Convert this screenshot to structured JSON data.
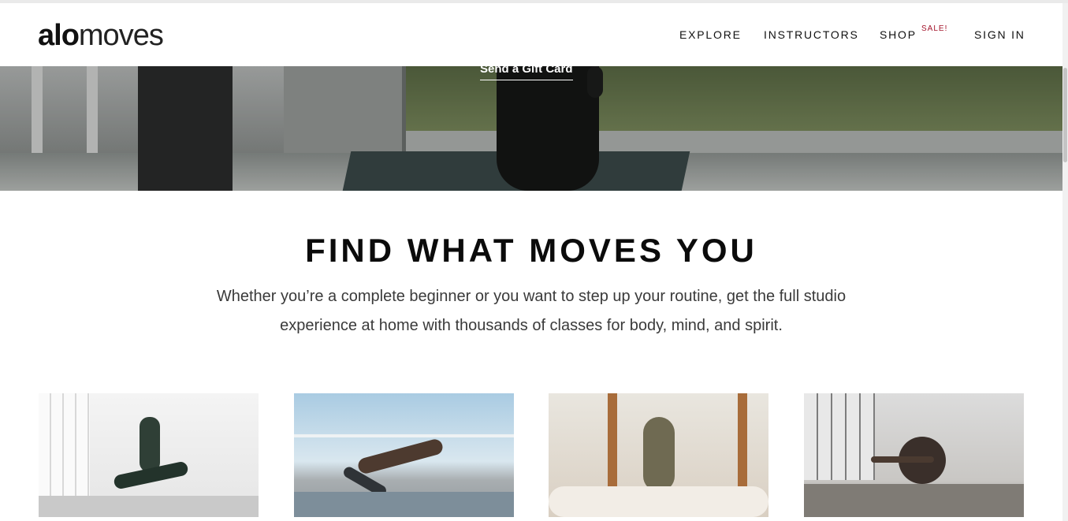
{
  "header": {
    "logo_bold": "alo",
    "logo_light": "moves",
    "nav": {
      "explore": "EXPLORE",
      "instructors": "INSTRUCTORS",
      "shop": "SHOP",
      "sale_badge": "SALE!",
      "sign_in": "SIGN IN"
    }
  },
  "hero": {
    "gift_link": "Send a Gift Card"
  },
  "section": {
    "title": "FIND WHAT MOVES YOU",
    "line1": "Whether you’re a complete beginner or you want to step up your routine, get the full studio",
    "line2": "experience at home with thousands of classes for body, mind, and spirit."
  },
  "colors": {
    "sale": "#a3132a",
    "text": "#111111",
    "body_text": "#3a3a3a"
  }
}
